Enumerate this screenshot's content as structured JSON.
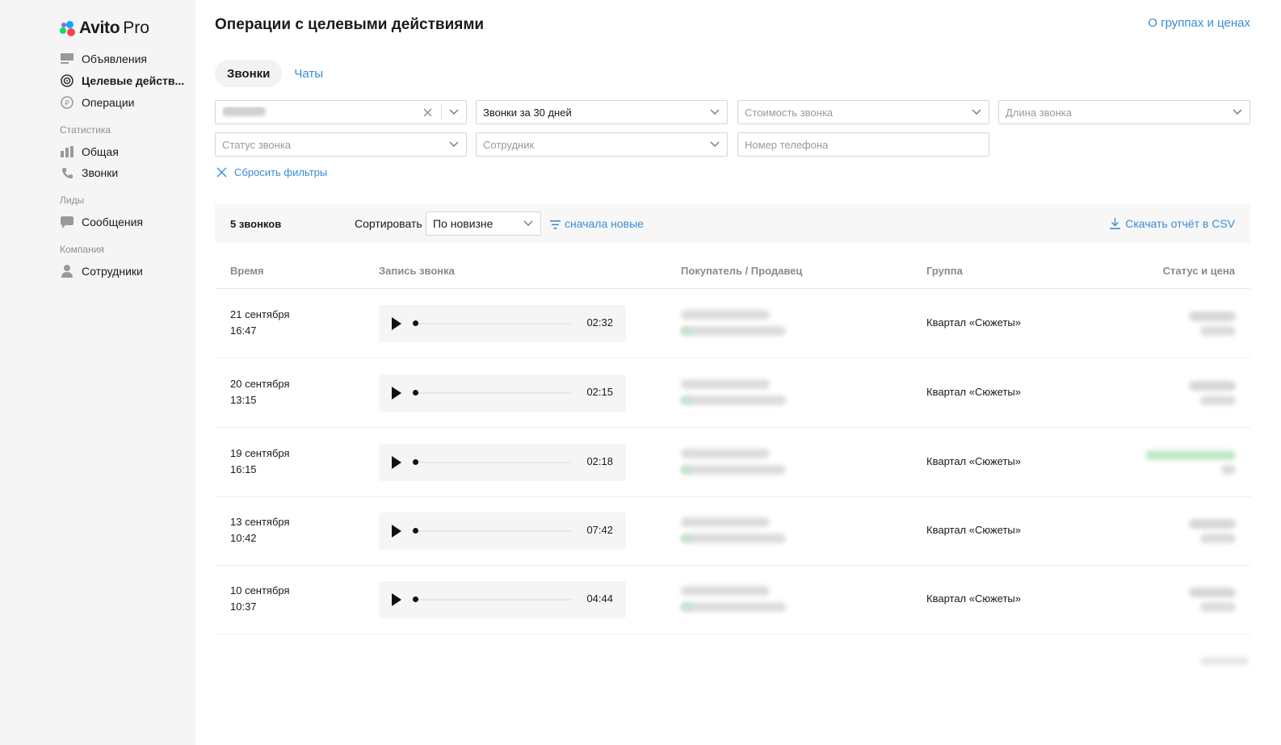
{
  "brand": {
    "name": "Avito",
    "suffix": "Pro"
  },
  "sidebar": {
    "items": [
      {
        "label": "Объявления",
        "icon": "list-icon"
      },
      {
        "label": "Целевые действ...",
        "icon": "target-icon",
        "active": true
      },
      {
        "label": "Операции",
        "icon": "operations-icon"
      }
    ],
    "sections": [
      {
        "title": "Статистика",
        "items": [
          {
            "label": "Общая",
            "icon": "bar-chart-icon"
          },
          {
            "label": "Звонки",
            "icon": "phone-icon"
          }
        ]
      },
      {
        "title": "Лиды",
        "items": [
          {
            "label": "Сообщения",
            "icon": "message-icon"
          }
        ]
      },
      {
        "title": "Компания",
        "items": [
          {
            "label": "Сотрудники",
            "icon": "user-icon"
          }
        ]
      }
    ]
  },
  "header": {
    "title": "Операции с целевыми действиями",
    "link": "О группах и ценах"
  },
  "tabs": [
    {
      "label": "Звонки",
      "active": true
    },
    {
      "label": "Чаты",
      "active": false
    }
  ],
  "filters": {
    "period": "Звонки за 30 дней",
    "cost_placeholder": "Стоимость звонка",
    "length_placeholder": "Длина звонка",
    "status_placeholder": "Статус звонка",
    "employee_placeholder": "Сотрудник",
    "phone_placeholder": "Номер телефона",
    "reset": "Сбросить фильтры"
  },
  "toolbar": {
    "count": "5 звонков",
    "sort_label": "Сортировать",
    "sort_value": "По новизне",
    "sort_order": "сначала новые",
    "download": "Скачать отчёт в CSV"
  },
  "table": {
    "columns": [
      "Время",
      "Запись звонка",
      "Покупатель / Продавец",
      "Группа",
      "Статус и цена"
    ],
    "rows": [
      {
        "date": "21 сентября",
        "time": "16:47",
        "duration": "02:32",
        "group": "Квартал «Сюжеты»"
      },
      {
        "date": "20 сентября",
        "time": "13:15",
        "duration": "02:15",
        "group": "Квартал «Сюжеты»"
      },
      {
        "date": "19 сентября",
        "time": "16:15",
        "duration": "02:18",
        "group": "Квартал «Сюжеты»"
      },
      {
        "date": "13 сентября",
        "time": "10:42",
        "duration": "07:42",
        "group": "Квартал «Сюжеты»"
      },
      {
        "date": "10 сентября",
        "time": "10:37",
        "duration": "04:44",
        "group": "Квартал «Сюжеты»"
      }
    ]
  },
  "colors": {
    "accent": "#3a8cd6",
    "sidebar_bg": "#f5f5f5",
    "green_status": "#bfe9c6"
  }
}
